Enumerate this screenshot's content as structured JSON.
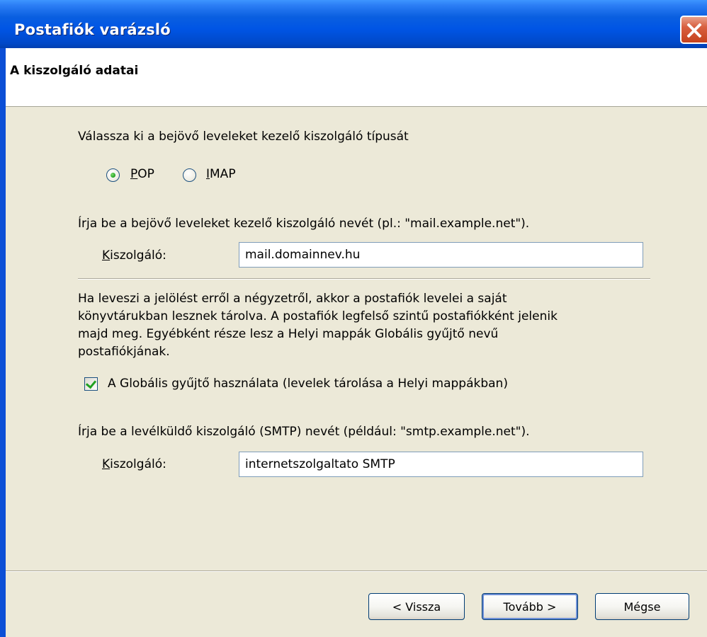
{
  "window": {
    "title": "Postafiók varázsló"
  },
  "header": {
    "title": "A kiszolgáló adatai"
  },
  "incoming": {
    "prompt": "Válassza ki a bejövő leveleket kezelő kiszolgáló típusát",
    "options": [
      {
        "label": "POP",
        "selected": true
      },
      {
        "label": "IMAP",
        "selected": false
      }
    ],
    "server_prompt": "Írja be a bejövő leveleket kezelő kiszolgáló nevét (pl.: \"mail.example.net\").",
    "server_label": "Kiszolgáló:",
    "server_value": "mail.domainnev.hu"
  },
  "global_inbox": {
    "description_lines": [
      "Ha leveszi a jelölést erről a négyzetről, akkor a postafiók levelei a saját",
      "könyvtárukban lesznek tárolva. A postafiók legfelső szintű postafiókként jelenik",
      "majd meg. Egyébként része lesz a Helyi mappák Globális gyűjtő nevű",
      "postafiókjának."
    ],
    "checkbox_label": "A Globális gyűjtő használata (levelek tárolása a Helyi mappákban)",
    "checked": true
  },
  "outgoing": {
    "prompt": "Írja be a levélküldő kiszolgáló (SMTP) nevét (például: \"smtp.example.net\").",
    "server_label": "Kiszolgáló:",
    "server_value": "internetszolgaltato SMTP"
  },
  "buttons": {
    "back": "< Vissza",
    "next": "Tovább >",
    "cancel": "Mégse"
  },
  "colors": {
    "titlebar": "#0055e5",
    "dialog_bg": "#ece9d8",
    "close": "#c6421d",
    "check": "#21a121"
  }
}
